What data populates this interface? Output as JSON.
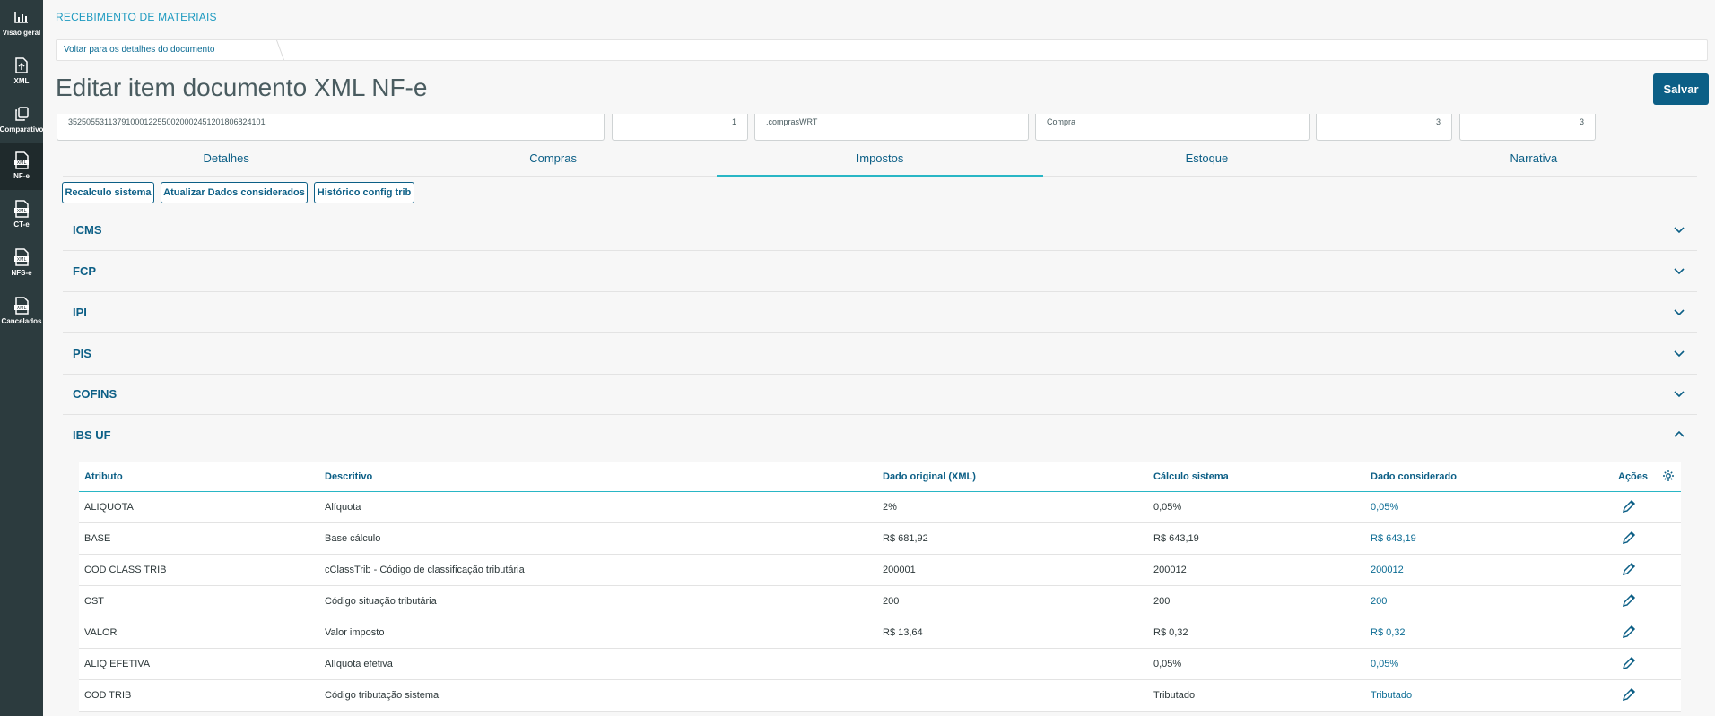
{
  "sidebar": {
    "items": [
      {
        "label": "Visão geral",
        "icon": "bar-chart-icon"
      },
      {
        "label": "XML",
        "icon": "file-upload-icon"
      },
      {
        "label": "Comparativo",
        "icon": "copy-icon"
      },
      {
        "label": "NF-e",
        "icon": "xml-file-icon"
      },
      {
        "label": "CT-e",
        "icon": "xml-file-icon"
      },
      {
        "label": "NFS-e",
        "icon": "xml-file-icon"
      },
      {
        "label": "Cancelados",
        "icon": "xml-file-icon"
      }
    ]
  },
  "header": {
    "module": "RECEBIMENTO DE MATERIAIS",
    "breadcrumb": "Voltar para os detalhes do documento",
    "title": "Editar item documento XML NF-e",
    "save_label": "Salvar"
  },
  "fields": [
    "35250553113791000122550020002451201806824101",
    "1",
    ".comprasWRT",
    "Compra",
    "3",
    "3"
  ],
  "tabs": [
    "Detalhes",
    "Compras",
    "Impostos",
    "Estoque",
    "Narrativa"
  ],
  "active_tab": "Impostos",
  "actions": [
    "Recalculo sistema",
    "Atualizar Dados considerados",
    "Histórico config trib"
  ],
  "sections": [
    "ICMS",
    "FCP",
    "IPI",
    "PIS",
    "COFINS",
    "IBS UF"
  ],
  "table": {
    "headers": {
      "atributo": "Atributo",
      "descritivo": "Descritivo",
      "original": "Dado original (XML)",
      "calculo": "Cálculo sistema",
      "considerado": "Dado considerado",
      "acoes": "Ações"
    },
    "rows": [
      {
        "atributo": "ALIQUOTA",
        "descritivo": "Alíquota",
        "original": "2%",
        "calculo": "0,05%",
        "considerado": "0,05%"
      },
      {
        "atributo": "BASE",
        "descritivo": "Base cálculo",
        "original": "R$ 681,92",
        "calculo": "R$ 643,19",
        "considerado": "R$ 643,19"
      },
      {
        "atributo": "COD CLASS TRIB",
        "descritivo": "cClassTrib - Código de classificação tributária",
        "original": "200001",
        "calculo": "200012",
        "considerado": "200012"
      },
      {
        "atributo": "CST",
        "descritivo": "Código situação tributária",
        "original": "200",
        "calculo": "200",
        "considerado": "200"
      },
      {
        "atributo": "VALOR",
        "descritivo": "Valor imposto",
        "original": "R$ 13,64",
        "calculo": "R$ 0,32",
        "considerado": "R$ 0,32"
      },
      {
        "atributo": "ALIQ EFETIVA",
        "descritivo": "Alíquota efetiva",
        "original": "",
        "calculo": "0,05%",
        "considerado": "0,05%"
      },
      {
        "atributo": "COD TRIB",
        "descritivo": "Código tributação sistema",
        "original": "",
        "calculo": "Tributado",
        "considerado": "Tributado"
      }
    ]
  },
  "colors": {
    "accent": "#29b6c5",
    "primary": "#0c5f86",
    "sidebar": "#2c3b3e"
  }
}
